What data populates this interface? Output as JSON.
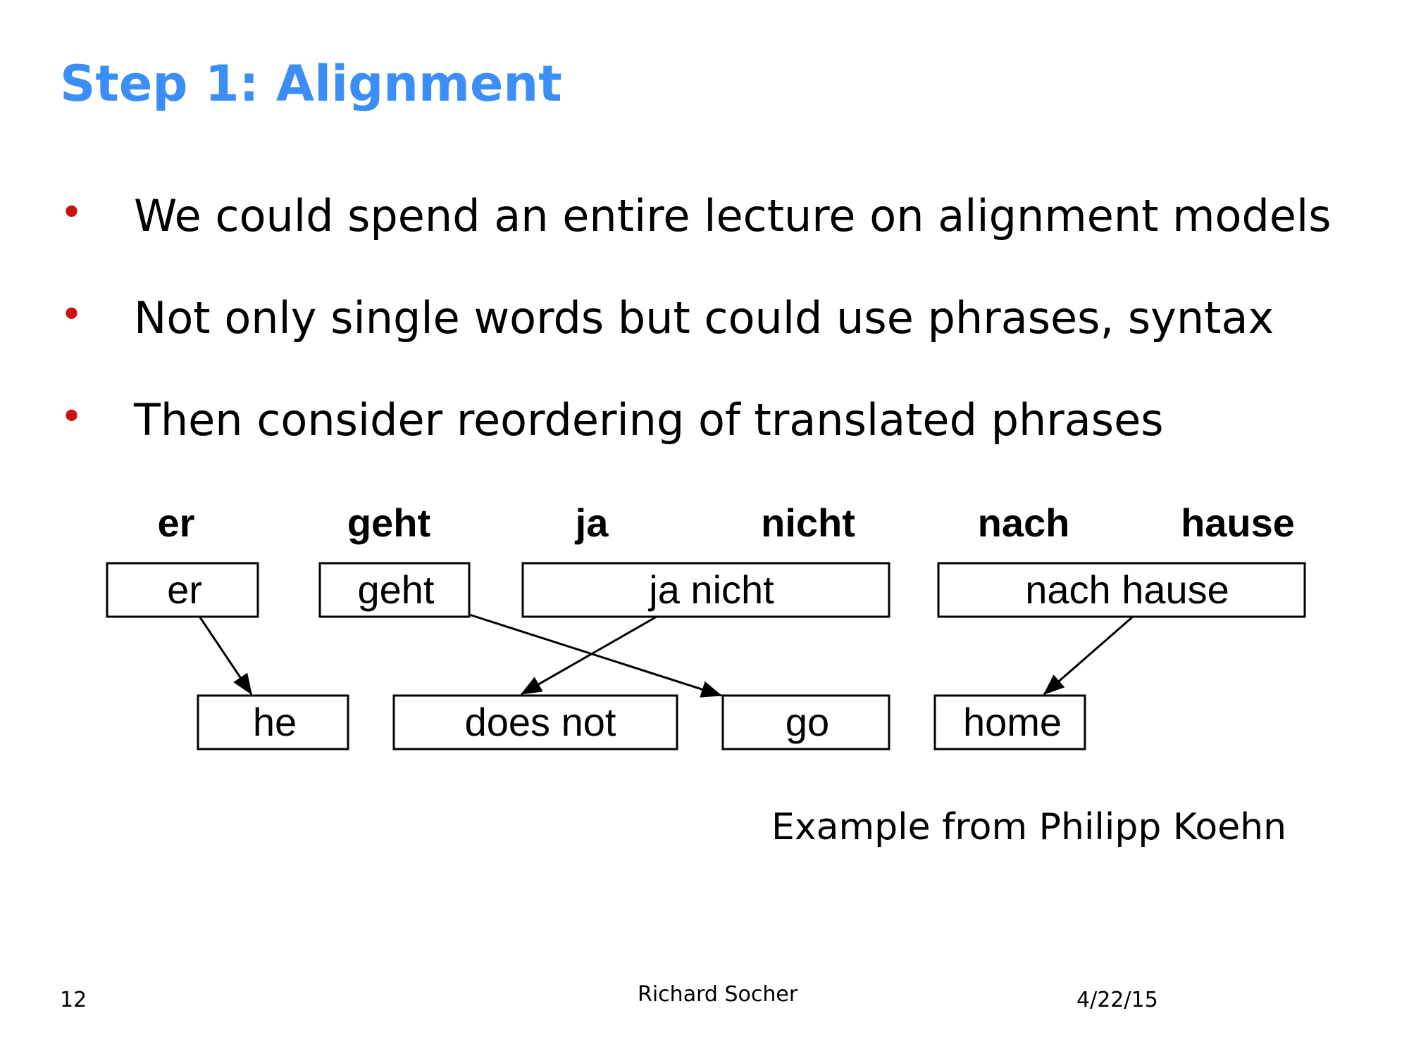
{
  "slide": {
    "title": "Step 1: Alignment",
    "bullets": [
      "We could spend an entire lecture on alignment models",
      "Not only single words but could use phrases, syntax",
      "Then consider reordering of translated phrases"
    ],
    "credit": "Example from Philipp Koehn"
  },
  "diagram": {
    "source_words": [
      "er",
      "geht",
      "ja",
      "nicht",
      "nach",
      "hause"
    ],
    "source_phrases": [
      "er",
      "geht",
      "ja nicht",
      "nach hause"
    ],
    "target_phrases": [
      "he",
      "does not",
      "go",
      "home"
    ],
    "alignments": [
      {
        "from": "er",
        "to": "he"
      },
      {
        "from": "geht",
        "to": "go"
      },
      {
        "from": "ja nicht",
        "to": "does not"
      },
      {
        "from": "nach hause",
        "to": "home"
      }
    ]
  },
  "footer": {
    "page_number": "12",
    "author": "Richard Socher",
    "date": "4/22/15"
  }
}
